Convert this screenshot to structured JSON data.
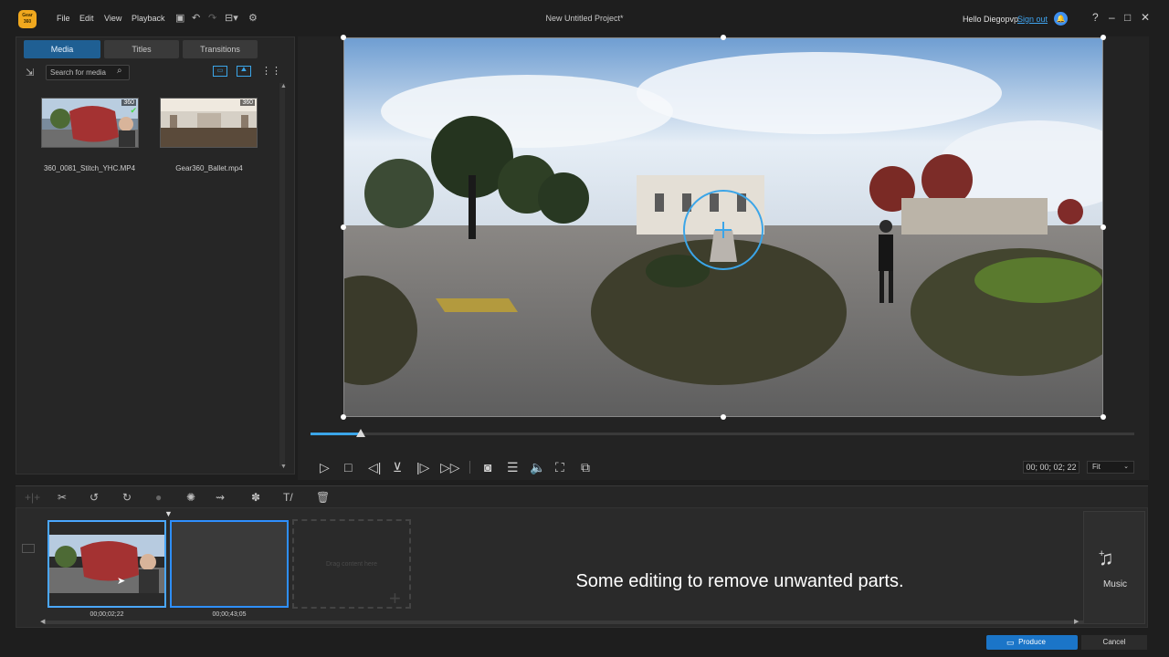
{
  "app": {
    "title": "New Untitled Project*",
    "logo_text": "Gear 360"
  },
  "menu": {
    "file": "File",
    "edit": "Edit",
    "view": "View",
    "playback": "Playback"
  },
  "account": {
    "hello": "Hello Diegopvp",
    "signout": "Sign out"
  },
  "window": {
    "help": "?",
    "minimize": "–",
    "maximize": "□",
    "close": "✕"
  },
  "library": {
    "tabs": {
      "media": "Media",
      "titles": "Titles",
      "transitions": "Transitions"
    },
    "search_placeholder": "Search for media",
    "items": [
      {
        "name": "360_0081_Stitch_YHC.MP4",
        "badge": "360"
      },
      {
        "name": "Gear360_Ballet.mp4",
        "badge": "360"
      }
    ]
  },
  "preview": {
    "timecode": "00; 00; 02; 22",
    "zoom": "Fit",
    "progress": 0.06
  },
  "timeline": {
    "clips": [
      {
        "duration": "00;00;02;22"
      },
      {
        "duration": "00;00;43;05"
      }
    ],
    "drop_hint": "Drag content here",
    "caption": "Some editing to remove unwanted parts.",
    "music_label": "Music"
  },
  "footer": {
    "produce": "Produce",
    "cancel": "Cancel"
  },
  "colors": {
    "accent": "#1b75c8",
    "tab_active": "#1f5f93",
    "logo": "#f0a81e",
    "selection": "#4aa7ff"
  }
}
